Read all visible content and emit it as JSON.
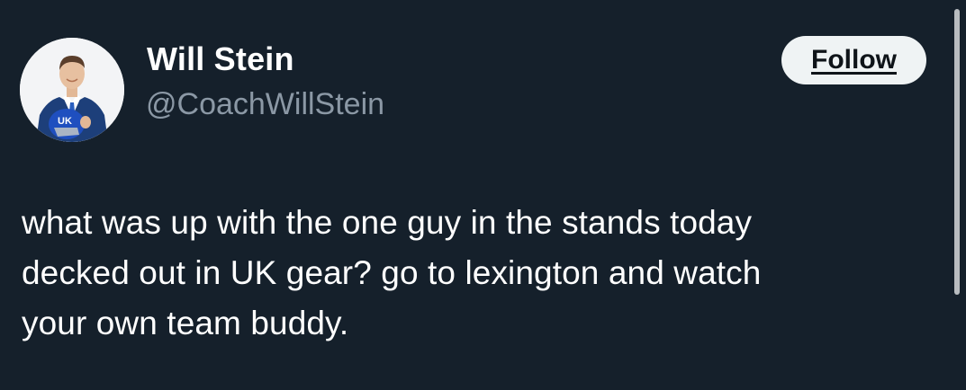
{
  "author": {
    "display_name": "Will Stein",
    "handle": "@CoachWillStein",
    "avatar_icon": "profile-photo-with-helmet",
    "helmet_logo": "UK"
  },
  "actions": {
    "follow_label": "Follow"
  },
  "tweet": {
    "lines": [
      "what was up with the one guy in the stands today",
      "decked out in UK gear? go to lexington and watch",
      "your own team buddy."
    ]
  },
  "colors": {
    "background": "#15202b",
    "handle": "#8b98a5",
    "follow_bg": "#eff3f4",
    "follow_text": "#0f1419",
    "helmet_blue": "#1f4fbf"
  }
}
